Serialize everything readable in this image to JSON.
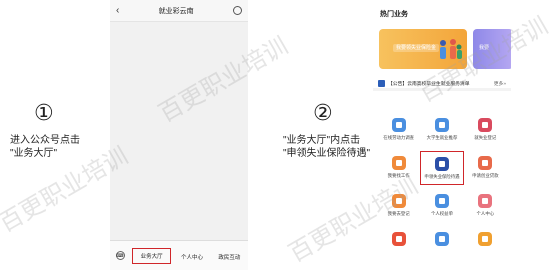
{
  "steps": [
    {
      "num": "①",
      "text": "进入公众号点击\n\"业务大厅\""
    },
    {
      "num": "②",
      "text": "\"业务大厅\"内点击\n\"申领失业保险待遇\""
    }
  ],
  "phone1": {
    "back": "‹",
    "title": "就业彩云南",
    "menu": [
      "业务大厅",
      "个人中心",
      "政民互动"
    ]
  },
  "phone2": {
    "section_title": "热门业务",
    "banner_1": "我要领失业保险金",
    "banner_2": "我要",
    "notice": "【公告】云南高校毕业生就业服务清单",
    "notice_more": "更多»",
    "services": [
      {
        "label": "在线劳动力调查",
        "icon": "survey-icon",
        "color": "#4a8fe0"
      },
      {
        "label": "大学生就业推荐",
        "icon": "grad-cap-icon",
        "color": "#4a8fe0"
      },
      {
        "label": "就失业登记",
        "icon": "registration-icon",
        "color": "#d94a5e"
      },
      {
        "label": "我要找工作",
        "icon": "job-search-icon",
        "color": "#f08a3a"
      },
      {
        "label": "申领失业保险待遇",
        "icon": "shield-icon",
        "color": "#2b4fa8"
      },
      {
        "label": "申请创业贷款",
        "icon": "loan-icon",
        "color": "#e86a4a"
      },
      {
        "label": "我要去登记",
        "icon": "enterprise-icon",
        "color": "#f08a3a"
      },
      {
        "label": "个人权益单",
        "icon": "umbrella-icon",
        "color": "#4a8fe0"
      },
      {
        "label": "个人中心",
        "icon": "heart-icon",
        "color": "#e9737e"
      },
      {
        "label": "",
        "icon": "chat-icon",
        "color": "#e8523a"
      },
      {
        "label": "",
        "icon": "document-icon",
        "color": "#4a8fe0"
      },
      {
        "label": "",
        "icon": "people-icon",
        "color": "#f0a030"
      }
    ]
  },
  "watermark": "百更职业培训"
}
